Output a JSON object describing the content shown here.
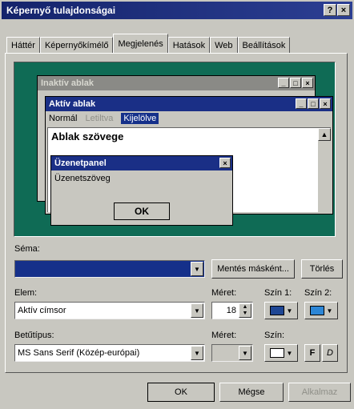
{
  "window": {
    "title": "Képernyő tulajdonságai",
    "help": "?",
    "close": "×"
  },
  "tabs": [
    "Háttér",
    "Képernyőkímélő",
    "Megjelenés",
    "Hatások",
    "Web",
    "Beállítások"
  ],
  "preview": {
    "inactive_title": "Inaktív ablak",
    "active_title": "Aktív ablak",
    "menu": [
      "Normál",
      "Letiltva",
      "Kijelölve"
    ],
    "window_text": "Ablak szövege",
    "msgbox_title": "Üzenetpanel",
    "msgbox_text": "Üzenetszöveg",
    "ok": "OK"
  },
  "scheme": {
    "label": "Séma:",
    "value": "",
    "save_as": "Mentés másként...",
    "delete": "Törlés"
  },
  "item": {
    "label": "Elem:",
    "value": "Aktív címsor",
    "size_label": "Méret:",
    "size_value": "18",
    "color1_label": "Szín 1:",
    "color2_label": "Szín 2:",
    "color1": "#1e4694",
    "color2": "#2c86d6"
  },
  "font": {
    "label": "Betűtípus:",
    "value": "MS Sans Serif (Közép-európai)",
    "size_label": "Méret:",
    "size_value": "",
    "color_label": "Szín:",
    "color": "#ffffff",
    "bold": "F",
    "italic": "D"
  },
  "buttons": {
    "ok": "OK",
    "cancel": "Mégse",
    "apply": "Alkalmaz"
  },
  "colors": {
    "desktop": "#0f6b55",
    "active": "#1a2f86",
    "inactive": "#8a8a86",
    "selection": "#15308a"
  }
}
